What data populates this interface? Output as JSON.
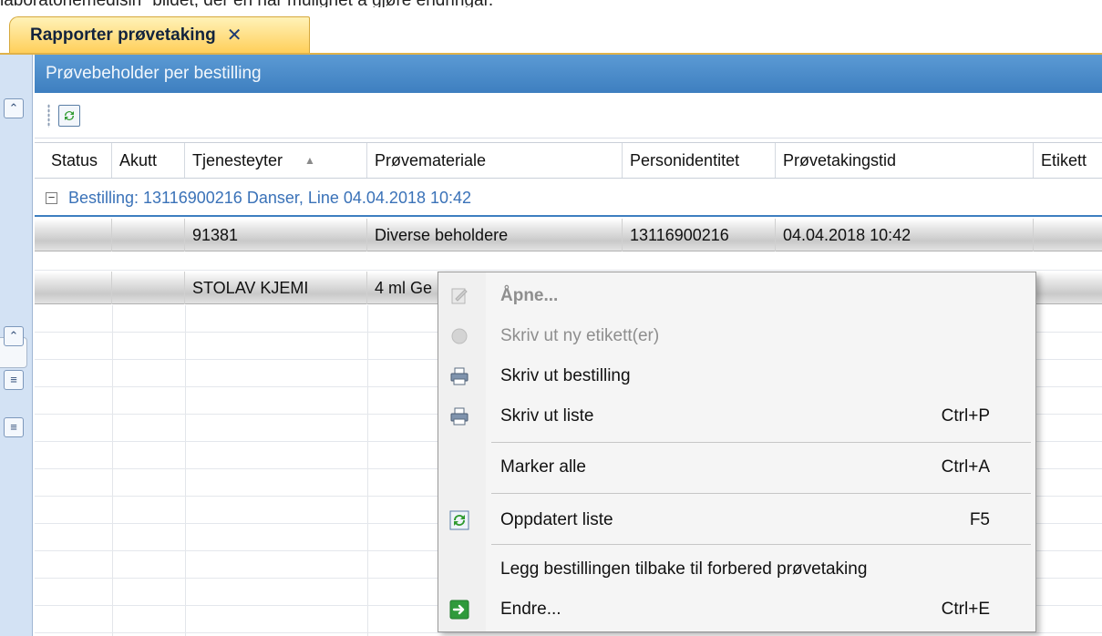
{
  "document_text": "laboratoriemedisin\" bildet, der en har mulighet å gjøre endringar.",
  "tab": {
    "label": "Rapporter prøvetaking",
    "close": "✕"
  },
  "panel": {
    "title": "Prøvebeholder per bestilling"
  },
  "grid": {
    "columns": [
      "Status",
      "Akutt",
      "Tjenesteyter",
      "Prøvemateriale",
      "Personidentitet",
      "Prøvetakingstid",
      "Etikett"
    ],
    "sort_indicator": "▲",
    "group_label": "Bestilling: 13116900216 Danser, Line 04.04.2018 10:42",
    "rows": [
      {
        "status": "",
        "akutt": "",
        "tjenesteyter": "91381",
        "provemateriale": "Diverse beholdere",
        "personidentitet": "13116900216",
        "provetakingstid": "04.04.2018 10:42",
        "etikett": ""
      },
      {
        "status": "",
        "akutt": "",
        "tjenesteyter": "STOLAV KJEMI",
        "provemateriale": "4 ml Ge",
        "personidentitet": "",
        "provetakingstid": "",
        "etikett": ""
      }
    ]
  },
  "context_menu": {
    "items": [
      {
        "label": "Åpne...",
        "shortcut": "",
        "icon": "edit-icon",
        "disabled": true,
        "bold": true
      },
      {
        "label": "Skriv ut ny etikett(er)",
        "shortcut": "",
        "icon": "label-print-icon",
        "disabled": true,
        "bold": false
      },
      {
        "label": "Skriv ut bestilling",
        "shortcut": "",
        "icon": "printer-icon",
        "disabled": false,
        "bold": false
      },
      {
        "label": "Skriv ut liste",
        "shortcut": "Ctrl+P",
        "icon": "printer-icon",
        "disabled": false,
        "bold": false
      },
      {
        "label": "Marker alle",
        "shortcut": "Ctrl+A",
        "icon": "",
        "disabled": false,
        "bold": false
      },
      {
        "label": "Oppdatert liste",
        "shortcut": "F5",
        "icon": "refresh-icon",
        "disabled": false,
        "bold": false
      },
      {
        "label": "Legg bestillingen tilbake til forbered prøvetaking",
        "shortcut": "",
        "icon": "",
        "disabled": false,
        "bold": false
      },
      {
        "label": "Endre...",
        "shortcut": "Ctrl+E",
        "icon": "arrow-right-icon",
        "disabled": false,
        "bold": false
      }
    ]
  },
  "colors": {
    "tab_gradient_start": "#fff2b8",
    "tab_gradient_end": "#ffcf5a",
    "panel_header": "#3e7fc0",
    "group_text": "#3a72b8",
    "rail": "#d3e2f4"
  }
}
